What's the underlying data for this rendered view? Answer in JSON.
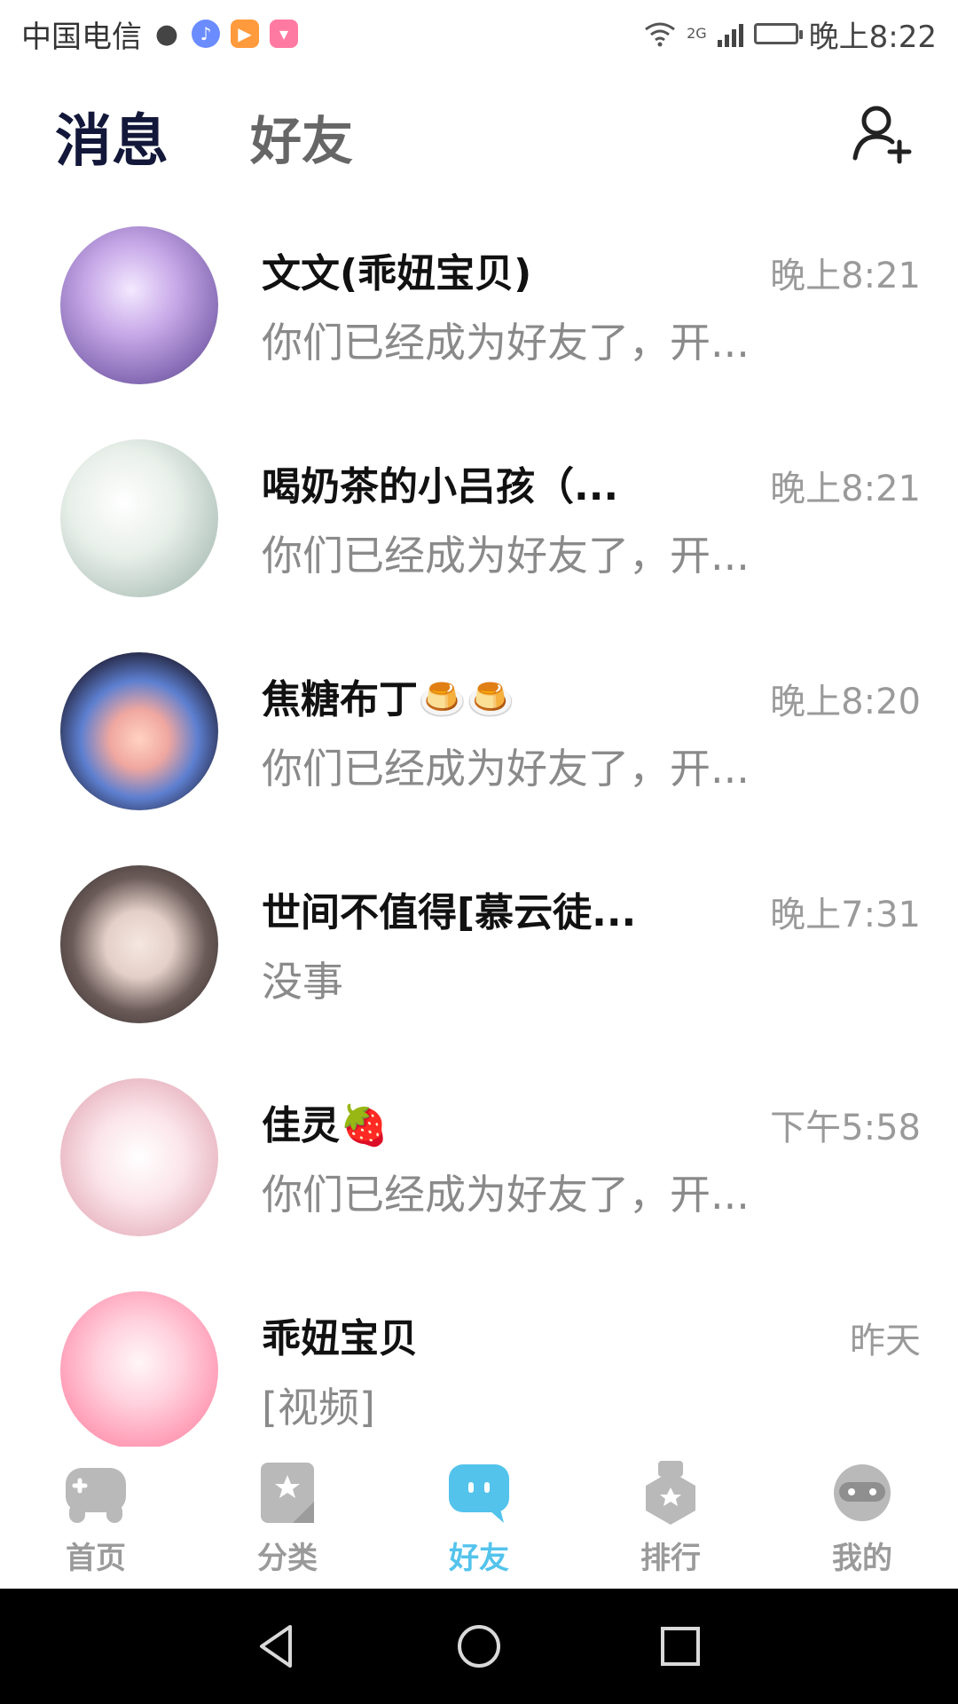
{
  "status_bar": {
    "carrier": "中国电信",
    "network": "2G",
    "time": "晚上8:22"
  },
  "header": {
    "tab_messages": "消息",
    "tab_friends": "好友"
  },
  "conversations": [
    {
      "name": "文文(乖妞宝贝)",
      "time": "晚上8:21",
      "preview": "你们已经成为好友了，开..."
    },
    {
      "name": "喝奶茶的小吕孩（...",
      "time": "晚上8:21",
      "preview": "你们已经成为好友了，开..."
    },
    {
      "name": "焦糖布丁🍮🍮",
      "time": "晚上8:20",
      "preview": "你们已经成为好友了，开..."
    },
    {
      "name": "世间不值得[慕云徒...",
      "time": "晚上7:31",
      "preview": "没事"
    },
    {
      "name": "佳灵🍓",
      "time": "下午5:58",
      "preview": "你们已经成为好友了，开..."
    },
    {
      "name": "乖妞宝贝",
      "time": "昨天",
      "preview": "[视频]"
    }
  ],
  "bottom_nav": [
    {
      "label": "首页",
      "icon": "gamepad-icon"
    },
    {
      "label": "分类",
      "icon": "category-icon"
    },
    {
      "label": "好友",
      "icon": "chat-bubble-icon",
      "active": true
    },
    {
      "label": "排行",
      "icon": "ranking-icon"
    },
    {
      "label": "我的",
      "icon": "profile-gamepad-icon"
    }
  ],
  "colors": {
    "accent": "#53c3ec",
    "title": "#13183a",
    "muted": "#9a9a9a"
  }
}
